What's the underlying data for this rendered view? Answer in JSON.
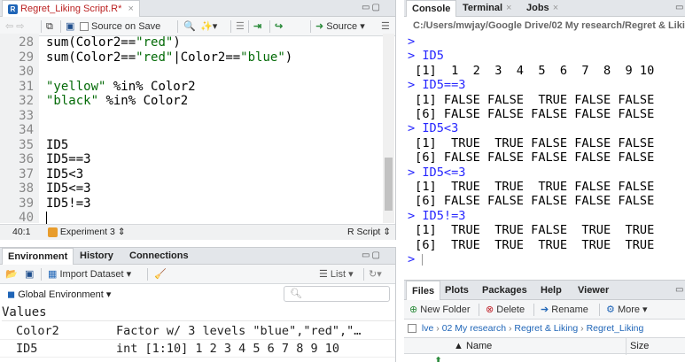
{
  "editor": {
    "tab_title": "Regret_Liking Script.R*",
    "toolbar": {
      "source_on_save": "Source on Save",
      "source": "Source"
    },
    "lines": [
      {
        "num": "28",
        "parts": [
          {
            "t": "sum(Color2==",
            "c": "code"
          },
          {
            "t": "\"red\"",
            "c": "str"
          },
          {
            "t": ")",
            "c": "code"
          }
        ]
      },
      {
        "num": "29",
        "parts": [
          {
            "t": "sum(Color2==",
            "c": "code"
          },
          {
            "t": "\"red\"",
            "c": "str"
          },
          {
            "t": "|Color2==",
            "c": "code"
          },
          {
            "t": "\"blue\"",
            "c": "str"
          },
          {
            "t": ")",
            "c": "code"
          }
        ]
      },
      {
        "num": "30",
        "parts": []
      },
      {
        "num": "31",
        "parts": [
          {
            "t": "\"yellow\"",
            "c": "str"
          },
          {
            "t": " %in% Color2",
            "c": "code"
          }
        ]
      },
      {
        "num": "32",
        "parts": [
          {
            "t": "\"black\"",
            "c": "str"
          },
          {
            "t": " %in% Color2",
            "c": "code"
          }
        ]
      },
      {
        "num": "33",
        "parts": []
      },
      {
        "num": "34",
        "parts": []
      },
      {
        "num": "35",
        "parts": [
          {
            "t": "ID5",
            "c": "code"
          }
        ]
      },
      {
        "num": "36",
        "parts": [
          {
            "t": "ID5==3",
            "c": "code"
          }
        ]
      },
      {
        "num": "37",
        "parts": [
          {
            "t": "ID5<3",
            "c": "code"
          }
        ]
      },
      {
        "num": "38",
        "parts": [
          {
            "t": "ID5<=3",
            "c": "code"
          }
        ]
      },
      {
        "num": "39",
        "parts": [
          {
            "t": "ID5!=3",
            "c": "code"
          }
        ]
      },
      {
        "num": "40",
        "parts": []
      }
    ],
    "status": {
      "position": "40:1",
      "section": "Experiment 3",
      "filetype": "R Script"
    }
  },
  "console": {
    "tabs": {
      "console": "Console",
      "terminal": "Terminal",
      "jobs": "Jobs"
    },
    "path": "C:/Users/mwjay/Google Drive/02 My research/Regret & Liking",
    "lines": [
      {
        "t": ">",
        "k": "prompt"
      },
      {
        "t": "> ID5",
        "k": "prompt"
      },
      {
        "t": " [1]  1  2  3  4  5  6  7  8  9 10",
        "k": "out"
      },
      {
        "t": "> ID5==3",
        "k": "prompt"
      },
      {
        "t": " [1] FALSE FALSE  TRUE FALSE FALSE",
        "k": "out"
      },
      {
        "t": " [6] FALSE FALSE FALSE FALSE FALSE",
        "k": "out"
      },
      {
        "t": "> ID5<3",
        "k": "prompt"
      },
      {
        "t": " [1]  TRUE  TRUE FALSE FALSE FALSE",
        "k": "out"
      },
      {
        "t": " [6] FALSE FALSE FALSE FALSE FALSE",
        "k": "out"
      },
      {
        "t": "> ID5<=3",
        "k": "prompt"
      },
      {
        "t": " [1]  TRUE  TRUE  TRUE FALSE FALSE",
        "k": "out"
      },
      {
        "t": " [6] FALSE FALSE FALSE FALSE FALSE",
        "k": "out"
      },
      {
        "t": "> ID5!=3",
        "k": "prompt"
      },
      {
        "t": " [1]  TRUE  TRUE FALSE  TRUE  TRUE",
        "k": "out"
      },
      {
        "t": " [6]  TRUE  TRUE  TRUE  TRUE  TRUE",
        "k": "out"
      },
      {
        "t": "> ",
        "k": "prompt"
      }
    ]
  },
  "environment": {
    "tabs": {
      "environment": "Environment",
      "history": "History",
      "connections": "Connections"
    },
    "import_dataset": "Import Dataset",
    "list_view": "List",
    "scope": "Global Environment",
    "section": "Values",
    "rows": [
      {
        "name": "Color2",
        "value": "Factor w/ 3 levels \"blue\",\"red\",\"…"
      },
      {
        "name": "ID5",
        "value": "int [1:10] 1 2 3 4 5 6 7 8 9 10"
      }
    ]
  },
  "files": {
    "tabs": {
      "files": "Files",
      "plots": "Plots",
      "packages": "Packages",
      "help": "Help",
      "viewer": "Viewer"
    },
    "toolbar": {
      "new_folder": "New Folder",
      "delete": "Delete",
      "rename": "Rename",
      "more": "More"
    },
    "breadcrumb": [
      "lve",
      "02 My research",
      "Regret & Liking",
      "Regret_Liking"
    ],
    "columns": {
      "name": "Name",
      "size": "Size"
    }
  },
  "colors": {
    "prompt": "#2626ff",
    "string": "#036a07"
  }
}
